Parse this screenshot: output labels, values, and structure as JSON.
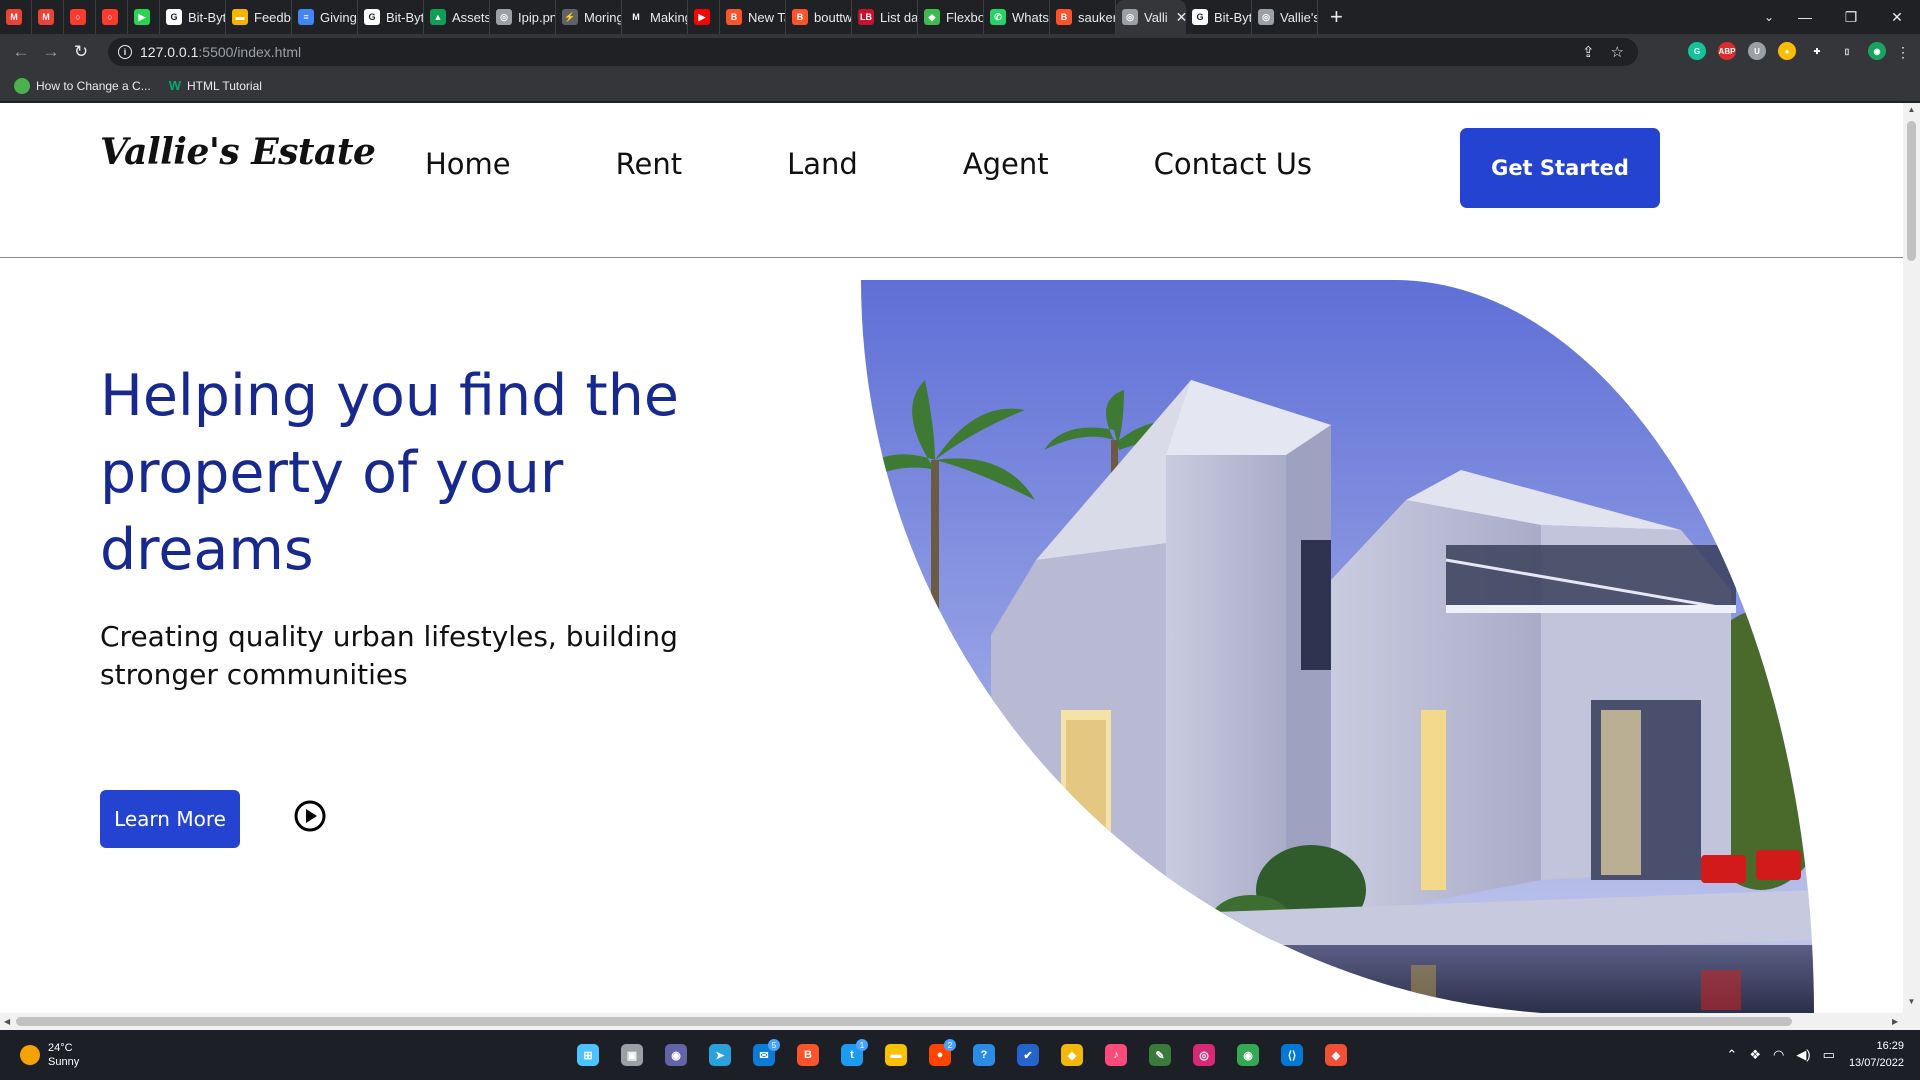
{
  "browser": {
    "tabs": [
      {
        "label": "",
        "favicon_color": "#ea4335",
        "favicon_text": "M"
      },
      {
        "label": "",
        "favicon_color": "#ea4335",
        "favicon_text": "M"
      },
      {
        "label": "",
        "favicon_color": "#ff3b30",
        "favicon_text": "○"
      },
      {
        "label": "",
        "favicon_color": "#ff3b30",
        "favicon_text": "○"
      },
      {
        "label": "",
        "favicon_color": "#2ad352",
        "favicon_text": "▶"
      },
      {
        "label": "Bit-Byte",
        "favicon_color": "#ffffff",
        "favicon_text": "G"
      },
      {
        "label": "Feedba",
        "favicon_color": "#f4b400",
        "favicon_text": "▬"
      },
      {
        "label": "Giving",
        "favicon_color": "#4285f4",
        "favicon_text": "≡"
      },
      {
        "label": "Bit-Byte",
        "favicon_color": "#ffffff",
        "favicon_text": "G"
      },
      {
        "label": "Assets",
        "favicon_color": "#0f9d58",
        "favicon_text": "▲"
      },
      {
        "label": "Ipip.png",
        "favicon_color": "#9aa0a6",
        "favicon_text": "◎"
      },
      {
        "label": "Moring",
        "favicon_color": "#5f6368",
        "favicon_text": "⚡"
      },
      {
        "label": "Making",
        "favicon_color": "#202124",
        "favicon_text": "M"
      },
      {
        "label": "",
        "favicon_color": "#ff0000",
        "favicon_text": "▶"
      },
      {
        "label": "New Ta",
        "favicon_color": "#fb542b",
        "favicon_text": "B"
      },
      {
        "label": "bouttw",
        "favicon_color": "#fb542b",
        "favicon_text": "B"
      },
      {
        "label": "List dat",
        "favicon_color": "#c4122f",
        "favicon_text": "LB"
      },
      {
        "label": "Flexbox",
        "favicon_color": "#3fb950",
        "favicon_text": "◆"
      },
      {
        "label": "WhatsA",
        "favicon_color": "#25d366",
        "favicon_text": "✆"
      },
      {
        "label": "saukera",
        "favicon_color": "#fb542b",
        "favicon_text": "B"
      },
      {
        "label": "Valli",
        "favicon_color": "#9aa0a6",
        "favicon_text": "◎",
        "active": true
      },
      {
        "label": "Bit-Byte",
        "favicon_color": "#ffffff",
        "favicon_text": "G"
      },
      {
        "label": "Vallie's",
        "favicon_color": "#9aa0a6",
        "favicon_text": "◎"
      }
    ],
    "new_tab": "+",
    "window_controls": [
      "—",
      "❐",
      "✕"
    ],
    "url_host": "127.0.0.1",
    "url_path": ":5500/index.html",
    "bookmarks": [
      {
        "label": "How to Change a C...",
        "icon_color": "#4caf50"
      },
      {
        "label": "HTML Tutorial",
        "icon_color": "#04aa6d"
      }
    ],
    "extensions": [
      {
        "name": "grammarly-icon",
        "color": "#15c39a",
        "text": "G"
      },
      {
        "name": "adblock-icon",
        "color": "#e02b2b",
        "text": "ABP"
      },
      {
        "name": "shield-extension-icon",
        "color": "#9aa0a6",
        "text": "U"
      },
      {
        "name": "color-extension-icon",
        "color": "#fbbc04",
        "text": "●"
      },
      {
        "name": "puzzle-icon",
        "color": "#35363a",
        "text": "✚"
      },
      {
        "name": "sidepanel-icon",
        "color": "#35363a",
        "text": "▯"
      },
      {
        "name": "profile-avatar-icon",
        "color": "#1aa260",
        "text": "◉"
      }
    ]
  },
  "site": {
    "logo": "Vallie's Estate",
    "nav": [
      "Home",
      "Rent",
      "Land",
      "Agent",
      "Contact Us"
    ],
    "cta": "Get Started",
    "hero_title": "Helping you find the property of your dreams",
    "hero_subtitle": "Creating quality urban lifestyles, building stronger communities",
    "learn_more": "Learn More"
  },
  "taskbar": {
    "temperature": "24°C",
    "weather": "Sunny",
    "time": "16:29",
    "date": "13/07/2022",
    "apps": [
      {
        "name": "windows-start-icon",
        "color": "#4cc2ff",
        "text": "⊞"
      },
      {
        "name": "task-view-icon",
        "color": "#9aa0a6",
        "text": "▣"
      },
      {
        "name": "teams-chat-icon",
        "color": "#6264a7",
        "text": "◉"
      },
      {
        "name": "telegram-icon",
        "color": "#2aa1da",
        "text": "➤"
      },
      {
        "name": "mail-icon",
        "color": "#0a7cd6",
        "text": "✉",
        "badge": "5"
      },
      {
        "name": "brave-icon",
        "color": "#fb542b",
        "text": "B"
      },
      {
        "name": "twitter-icon",
        "color": "#1d9bf0",
        "text": "t",
        "badge": "1"
      },
      {
        "name": "file-explorer-icon",
        "color": "#f8c200",
        "text": "▬"
      },
      {
        "name": "reddit-icon",
        "color": "#ff4500",
        "text": "●",
        "badge": "2"
      },
      {
        "name": "help-icon",
        "color": "#2b8ce6",
        "text": "?"
      },
      {
        "name": "todo-icon",
        "color": "#2564cf",
        "text": "✔"
      },
      {
        "name": "binance-icon",
        "color": "#f0b90b",
        "text": "◆"
      },
      {
        "name": "itunes-icon",
        "color": "#fa4b7a",
        "text": "♪"
      },
      {
        "name": "inkscape-icon",
        "color": "#3a7a3a",
        "text": "✎"
      },
      {
        "name": "instagram-icon",
        "color": "#d62976",
        "text": "◎"
      },
      {
        "name": "chrome-icon",
        "color": "#34a853",
        "text": "◉"
      },
      {
        "name": "vscode-icon",
        "color": "#0078d4",
        "text": "⟨⟩"
      },
      {
        "name": "git-icon",
        "color": "#f05033",
        "text": "◆"
      }
    ]
  }
}
